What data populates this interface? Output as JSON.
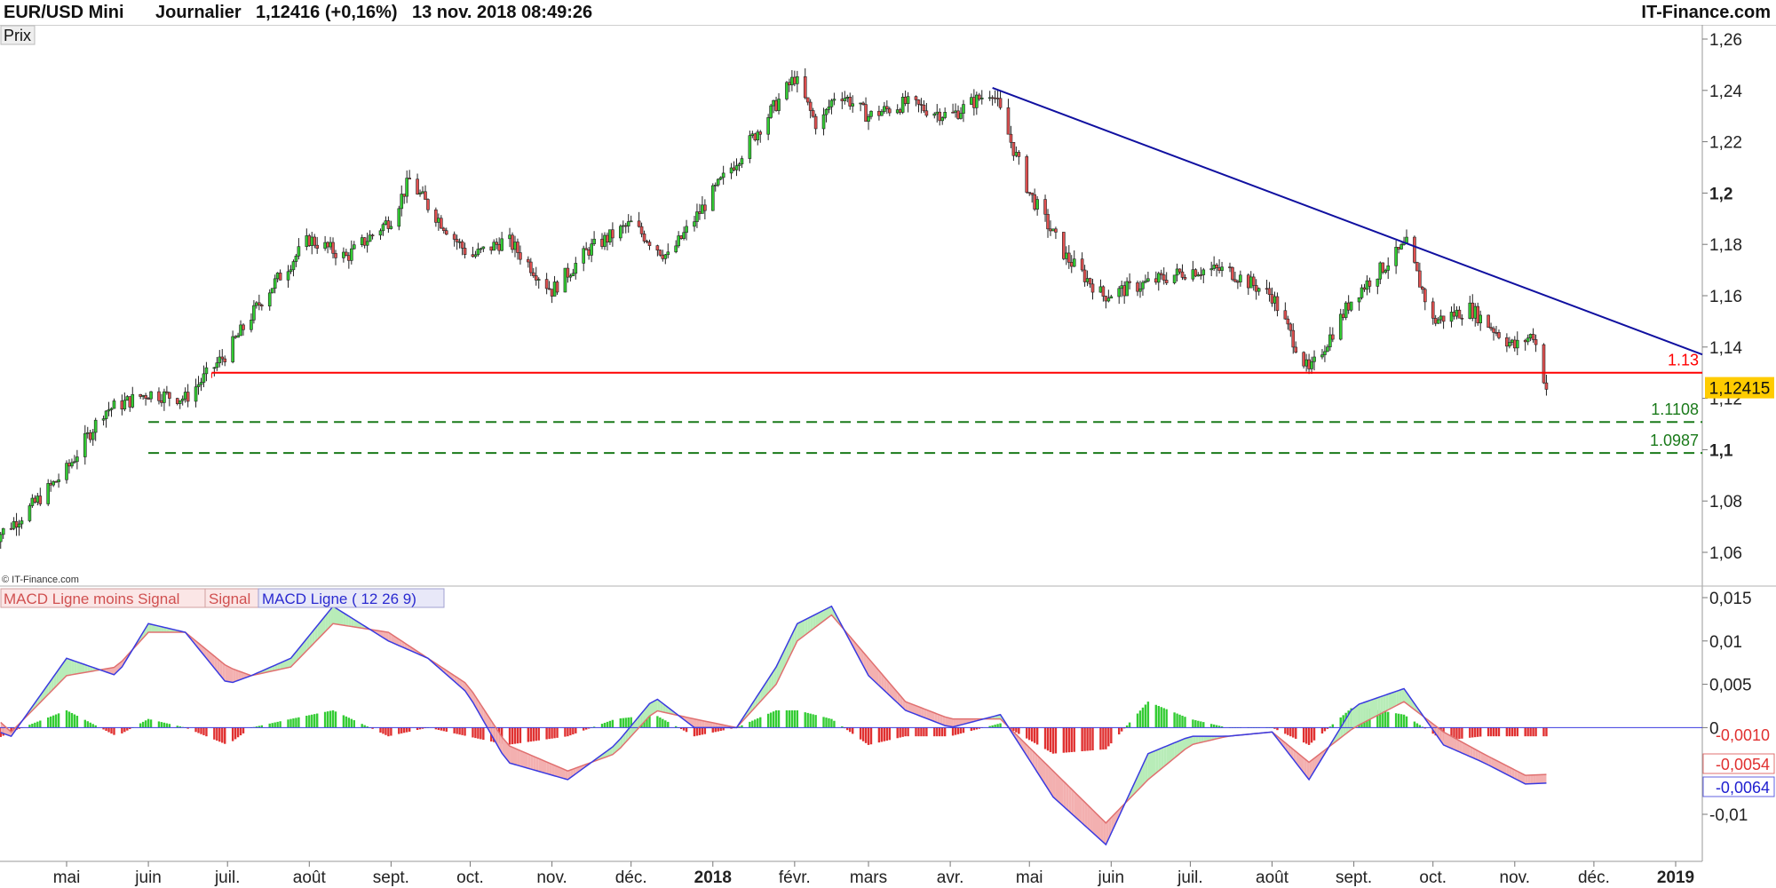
{
  "header": {
    "instrument": "EUR/USD Mini",
    "period": "Journalier",
    "quote": "1,12416 (+0,16%)",
    "datetime": "13 nov. 2018 08:49:26",
    "brand": "IT-Finance.com"
  },
  "price_panel": {
    "tab_label": "Prix",
    "copyright": "© IT-Finance.com",
    "last_price_label": "1,12415"
  },
  "macd_panel": {
    "legend_hist": "MACD Ligne moins Signal",
    "legend_signal": "Signal",
    "legend_macd": "MACD Ligne ( 12 26 9)",
    "value_hist": "-0,0010",
    "value_signal": "-0,0054",
    "value_macd": "-0,0064"
  },
  "colors": {
    "up_candle": "#33cc33",
    "down_candle": "#e05050",
    "trendline": "#1010a0",
    "support": "#ff0000",
    "target_lines": "#1a7a1a",
    "macd_line": "#3a3ae0",
    "signal_line": "#e07070",
    "hist_up": "#33cc33",
    "hist_down": "#e03030",
    "last_price_bg": "#ffcc00"
  },
  "chart_data": [
    {
      "type": "line",
      "title": "EUR/USD Mini",
      "subtitle": "Journalier",
      "ylim": [
        1.05,
        1.26
      ],
      "y_ticks": [
        "1,06",
        "1,08",
        "1,1",
        "1,12",
        "1,14",
        "1,16",
        "1,18",
        "1,2",
        "1,22",
        "1,24",
        "1,26"
      ],
      "x_ticks": [
        "mai",
        "juin",
        "juil.",
        "août",
        "sept.",
        "oct.",
        "nov.",
        "déc.",
        "2018",
        "févr.",
        "mars",
        "avr.",
        "mai",
        "juin",
        "juil.",
        "août",
        "sept.",
        "oct.",
        "nov.",
        "déc.",
        "2019"
      ],
      "series": [
        {
          "x": [
            "2017-04-03",
            "2017-04-15",
            "2017-05-01",
            "2017-05-15",
            "2017-06-01",
            "2017-06-15",
            "2017-07-01",
            "2017-07-15",
            "2017-08-01",
            "2017-08-15",
            "2017-09-01",
            "2017-09-08",
            "2017-09-15",
            "2017-10-01",
            "2017-10-15",
            "2017-11-01",
            "2017-11-15",
            "2017-12-01",
            "2017-12-15",
            "2018-01-01",
            "2018-01-15",
            "2018-02-01",
            "2018-02-10",
            "2018-02-17",
            "2018-03-01",
            "2018-03-15",
            "2018-04-01",
            "2018-04-17",
            "2018-05-01",
            "2018-05-15",
            "2018-05-29",
            "2018-06-15",
            "2018-07-01",
            "2018-07-15",
            "2018-08-01",
            "2018-08-15",
            "2018-09-01",
            "2018-09-21",
            "2018-10-01",
            "2018-10-15",
            "2018-11-01",
            "2018-11-08",
            "2018-11-13"
          ],
          "values": [
            1.065,
            1.075,
            1.092,
            1.115,
            1.122,
            1.12,
            1.138,
            1.16,
            1.182,
            1.175,
            1.19,
            1.205,
            1.195,
            1.175,
            1.182,
            1.162,
            1.178,
            1.188,
            1.175,
            1.2,
            1.22,
            1.245,
            1.225,
            1.24,
            1.23,
            1.235,
            1.23,
            1.24,
            1.2,
            1.175,
            1.16,
            1.165,
            1.17,
            1.17,
            1.16,
            1.13,
            1.16,
            1.18,
            1.15,
            1.155,
            1.14,
            1.145,
            1.124
          ]
        }
      ],
      "annotations": [
        {
          "label": "1.13",
          "value": 1.13
        },
        {
          "label": "1.1108",
          "value": 1.1108
        },
        {
          "label": "1.0987",
          "value": 1.0987
        }
      ],
      "trendline": {
        "start": {
          "x": "2018-04-17",
          "y": 1.241
        },
        "end": {
          "x": "2019-01-01",
          "y": 1.141
        }
      },
      "last_price": 1.12415,
      "grid": false
    },
    {
      "type": "line",
      "title": "MACD Ligne ( 12 26 9)",
      "ylim": [
        -0.0135,
        0.0155
      ],
      "y_ticks": [
        "-0,01",
        "0",
        "0,005",
        "0,01",
        "0,015"
      ],
      "x": [
        "2017-04-01",
        "2017-04-10",
        "2017-05-01",
        "2017-05-20",
        "2017-06-01",
        "2017-06-15",
        "2017-07-01",
        "2017-07-10",
        "2017-07-25",
        "2017-08-10",
        "2017-08-31",
        "2017-09-15",
        "2017-09-30",
        "2017-10-15",
        "2017-11-07",
        "2017-11-25",
        "2017-12-10",
        "2017-12-25",
        "2018-01-10",
        "2018-01-25",
        "2018-02-02",
        "2018-02-15",
        "2018-03-01",
        "2018-03-15",
        "2018-04-01",
        "2018-04-20",
        "2018-05-10",
        "2018-05-30",
        "2018-06-15",
        "2018-07-01",
        "2018-07-15",
        "2018-08-01",
        "2018-08-15",
        "2018-09-01",
        "2018-09-20",
        "2018-10-05",
        "2018-10-20",
        "2018-11-05",
        "2018-11-13"
      ],
      "series": [
        {
          "name": "MACD Ligne",
          "values": [
            0.0,
            -0.001,
            0.008,
            0.006,
            0.012,
            0.011,
            0.005,
            0.006,
            0.008,
            0.014,
            0.01,
            0.008,
            0.004,
            -0.004,
            -0.006,
            -0.002,
            0.0035,
            0.0,
            0.0,
            0.007,
            0.012,
            0.014,
            0.006,
            0.002,
            0.0,
            0.0015,
            -0.008,
            -0.0135,
            -0.003,
            -0.001,
            -0.001,
            -0.0005,
            -0.006,
            0.0025,
            0.0045,
            -0.002,
            -0.004,
            -0.0065,
            -0.0064
          ]
        },
        {
          "name": "Signal",
          "values": [
            0.002,
            -0.0005,
            0.006,
            0.007,
            0.011,
            0.011,
            0.007,
            0.006,
            0.007,
            0.012,
            0.011,
            0.008,
            0.005,
            -0.002,
            -0.005,
            -0.003,
            0.002,
            0.001,
            0.0,
            0.005,
            0.01,
            0.013,
            0.008,
            0.003,
            0.001,
            0.001,
            -0.005,
            -0.011,
            -0.006,
            -0.002,
            -0.001,
            -0.0005,
            -0.004,
            0.0,
            0.003,
            -0.0005,
            -0.003,
            -0.0055,
            -0.0054
          ]
        },
        {
          "name": "MACD Ligne moins Signal",
          "values": [
            -0.0018,
            -0.0005,
            0.002,
            -0.001,
            0.001,
            0.0,
            -0.002,
            0.0,
            0.001,
            0.002,
            -0.001,
            0.0,
            -0.001,
            -0.002,
            -0.001,
            0.001,
            0.0015,
            -0.001,
            0.0,
            0.002,
            0.002,
            0.001,
            -0.002,
            -0.001,
            -0.001,
            0.0005,
            -0.003,
            -0.0025,
            0.003,
            0.001,
            0.0,
            0.0,
            -0.002,
            0.0025,
            0.0015,
            -0.0015,
            -0.001,
            -0.001,
            -0.001
          ]
        }
      ],
      "grid": false
    }
  ]
}
